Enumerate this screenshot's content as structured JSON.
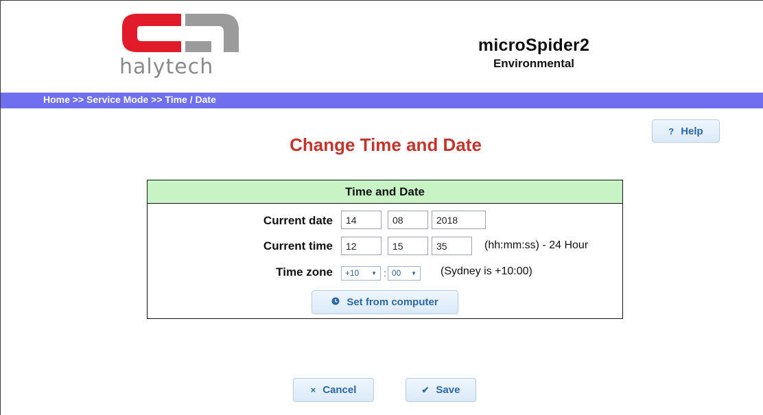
{
  "header": {
    "logo_text": "halytech",
    "product_name": "microSpider2",
    "product_subtitle": "Environmental"
  },
  "nav": {
    "breadcrumb": "Home >> Service Mode >> Time / Date"
  },
  "help_button": {
    "label": "Help",
    "icon": "?"
  },
  "page_title": "Change Time and Date",
  "panel": {
    "heading": "Time and Date",
    "date": {
      "label": "Current date",
      "day": "14",
      "month": "08",
      "year": "2018"
    },
    "time": {
      "label": "Current time",
      "hours": "12",
      "minutes": "15",
      "seconds": "35",
      "format_note": "(hh:mm:ss) - 24 Hour"
    },
    "timezone": {
      "label": "Time zone",
      "hours": "+10",
      "minutes": "00",
      "separator": ":",
      "note": "(Sydney is +10:00)"
    },
    "set_from_computer": {
      "label": "Set from computer",
      "icon": "clock-icon"
    }
  },
  "actions": {
    "cancel": {
      "label": "Cancel",
      "icon": "×"
    },
    "save": {
      "label": "Save",
      "icon": "✔"
    }
  },
  "colors": {
    "nav_bar": "#6f6ff0",
    "title": "#c2352d",
    "panel_header": "#c7f3c5",
    "logo_red": "#e21b2a",
    "logo_grey": "#9b9b9b",
    "button_text": "#2a67a6"
  }
}
